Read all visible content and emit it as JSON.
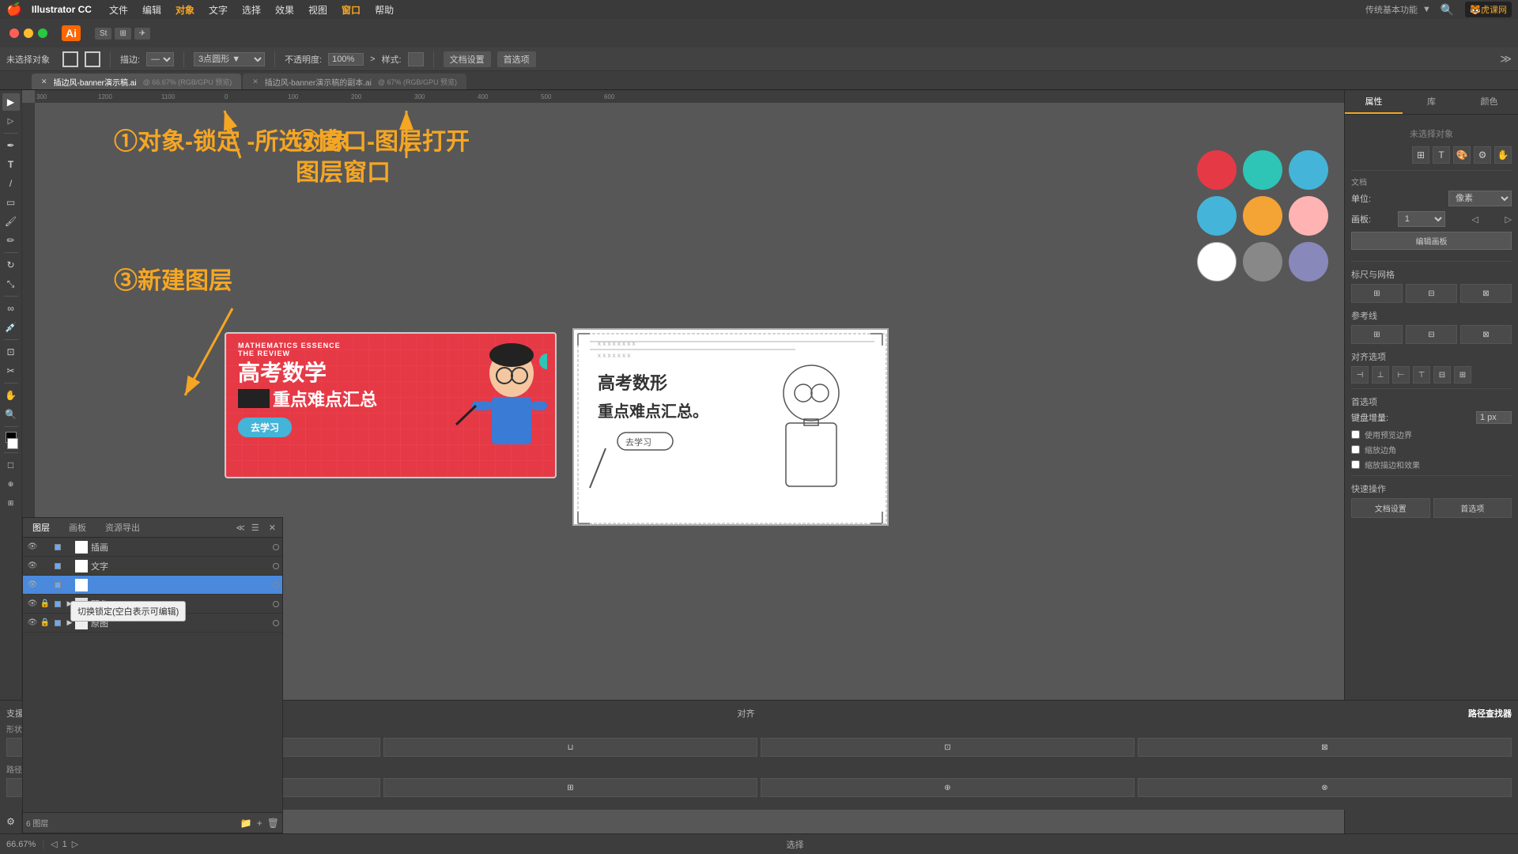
{
  "app": {
    "name": "Illustrator CC",
    "logo": "Ai",
    "zoom": "66.67%"
  },
  "menubar": {
    "apple": "🍎",
    "items": [
      "Illustrator CC",
      "文件",
      "编辑",
      "对象",
      "文字",
      "选择",
      "效果",
      "视图",
      "窗口",
      "帮助"
    ]
  },
  "toolbar_top": {
    "no_selection": "未选择对象",
    "stroke_label": "描边:",
    "opacity_label": "不透明度:",
    "opacity_value": "100%",
    "style_label": "样式:",
    "doc_settings": "文档设置",
    "preferences": "首选项"
  },
  "tabs": [
    {
      "name": "插边风-banner演示稿.ai",
      "suffix": "@ 66.67% (RGB/GPU 预览)",
      "active": true
    },
    {
      "name": "插边风-banner演示稿的副本.ai",
      "suffix": "@ 67% (RGB/GPU 预览)",
      "active": false
    }
  ],
  "annotations": {
    "step1": "①对象-锁定\n-所选对象",
    "step2": "②窗口-图层打开\n图层窗口",
    "step3": "③新建图层"
  },
  "layers_panel": {
    "title": "图层",
    "tabs": [
      "图层",
      "画板",
      "资源导出"
    ],
    "layers": [
      {
        "name": "插画",
        "visible": true,
        "locked": false,
        "color": "#66aaff",
        "expanded": false,
        "hasChildren": false
      },
      {
        "name": "文字",
        "visible": true,
        "locked": false,
        "color": "#66aaff",
        "expanded": false,
        "hasChildren": false
      },
      {
        "name": "",
        "visible": true,
        "locked": false,
        "color": "#66aaff",
        "expanded": false,
        "hasChildren": false,
        "editing": true
      },
      {
        "name": "配色",
        "visible": true,
        "locked": false,
        "color": "#66aaff",
        "expanded": true,
        "hasChildren": true
      },
      {
        "name": "原图",
        "visible": true,
        "locked": true,
        "color": "#66aaff",
        "expanded": false,
        "hasChildren": false
      }
    ],
    "layer_count": "6 图层",
    "tooltip": "切换锁定(空白表示可编辑)"
  },
  "right_panel": {
    "tabs": [
      "属性",
      "库",
      "颜色"
    ],
    "no_selection": "未选择对象",
    "doc_section": "文档",
    "unit_label": "单位:",
    "unit_value": "像素",
    "artboard_label": "画板:",
    "artboard_value": "1",
    "edit_artboard_btn": "编辑画板",
    "grid_align_title": "标尺与网格",
    "guides_title": "参考线",
    "align_title": "对齐选项",
    "preferences_title": "首选项",
    "keyboard_increment": "键盘增量:",
    "keyboard_value": "1 px",
    "use_preview_bounds": "使用预览边界",
    "scale_corners": "缩放边角",
    "scale_strokes": "缩放描边和效果",
    "quick_actions_title": "快速操作",
    "doc_settings_btn": "文档设置",
    "preferences_btn": "首选项"
  },
  "color_swatches": [
    "#e63946",
    "#2ec4b6",
    "#44b4d8",
    "#44b4d8",
    "#f4a335",
    "#ffb3b3",
    "#ffffff",
    "#888888",
    "#8888bb"
  ],
  "pathfinder": {
    "title": "路径查找器",
    "shape_mode_label": "形状模式:",
    "path_finder_label": "路径查找器:"
  },
  "footer": {
    "zoom": "66.67%",
    "selection_tool": "选择"
  },
  "canvas": {
    "banner_text1": "MATHEMATICS ESSENCE",
    "banner_text2": "THE REVIEW",
    "banner_title": "高考数学",
    "banner_subtitle": "重点难点汇总",
    "banner_btn": "去学习",
    "sketch_title1": "高考数形",
    "sketch_title2": "重点难点汇总",
    "sketch_btn": "去学习"
  }
}
